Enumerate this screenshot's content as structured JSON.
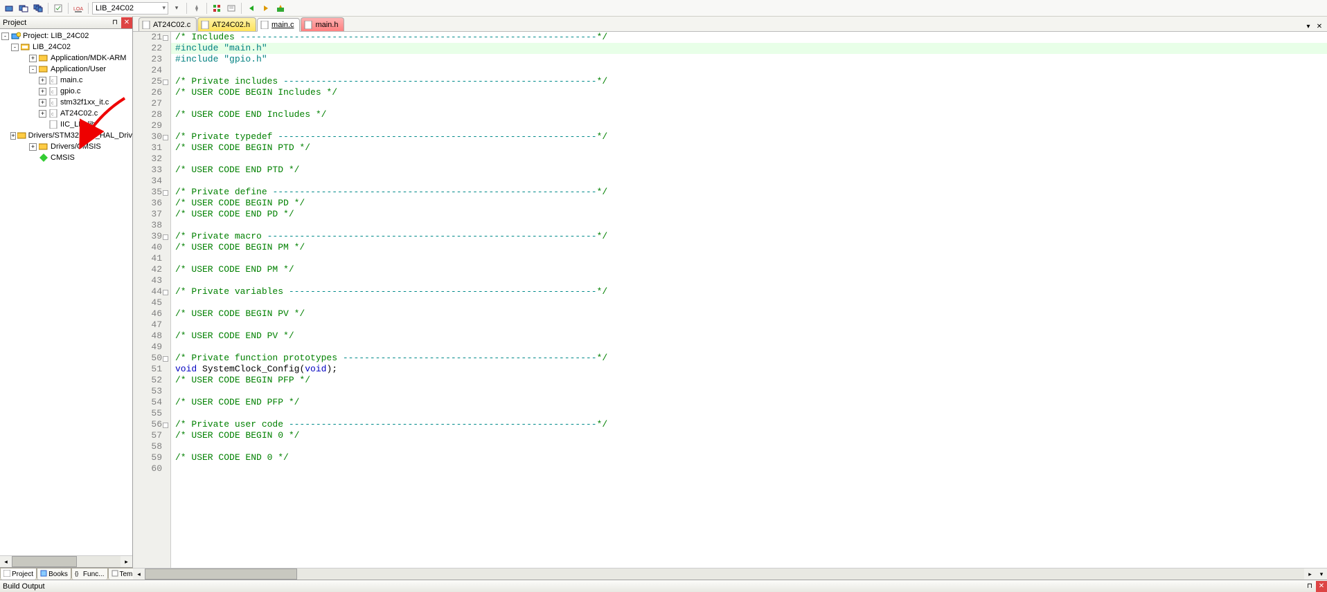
{
  "toolbar": {
    "target": "LIB_24C02"
  },
  "projectPanel": {
    "title": "Project",
    "root": "Project: LIB_24C02",
    "tree": {
      "rootGroup": "LIB_24C02",
      "nodes": [
        {
          "label": "Application/MDK-ARM",
          "icon": "folder",
          "indent": 3,
          "exp": "+"
        },
        {
          "label": "Application/User",
          "icon": "folder",
          "indent": 3,
          "exp": "-"
        },
        {
          "label": "main.c",
          "icon": "file-c",
          "indent": 4,
          "exp": "+"
        },
        {
          "label": "gpio.c",
          "icon": "file-c",
          "indent": 4,
          "exp": "+"
        },
        {
          "label": "stm32f1xx_it.c",
          "icon": "file-c",
          "indent": 4,
          "exp": "+"
        },
        {
          "label": "AT24C02.c",
          "icon": "file-c",
          "indent": 4,
          "exp": "+"
        },
        {
          "label": "IIC_LIB.lib",
          "icon": "file-lib",
          "indent": 4,
          "exp": ""
        },
        {
          "label": "Drivers/STM32F1xx_HAL_Driv",
          "icon": "folder",
          "indent": 3,
          "exp": "+"
        },
        {
          "label": "Drivers/CMSIS",
          "icon": "folder",
          "indent": 3,
          "exp": "+"
        },
        {
          "label": "CMSIS",
          "icon": "rte",
          "indent": 3,
          "exp": ""
        }
      ]
    },
    "bottomTabs": [
      "Project",
      "Books",
      "Func...",
      "Temp..."
    ]
  },
  "editor": {
    "tabs": [
      {
        "label": "AT24C02.c",
        "style": "normal"
      },
      {
        "label": "AT24C02.h",
        "style": "yellow"
      },
      {
        "label": "main.c",
        "style": "active underline"
      },
      {
        "label": "main.h",
        "style": "red"
      }
    ],
    "startLine": 21,
    "lines": [
      {
        "c": "cmt",
        "t": "/* Includes ------------------------------------------------------------------*/"
      },
      {
        "c": "pp",
        "t": "#include \"main.h\"",
        "hl": true
      },
      {
        "c": "pp",
        "t": "#include \"gpio.h\""
      },
      {
        "c": "",
        "t": ""
      },
      {
        "c": "cmt",
        "t": "/* Private includes ----------------------------------------------------------*/"
      },
      {
        "c": "cmt",
        "t": "/* USER CODE BEGIN Includes */"
      },
      {
        "c": "",
        "t": ""
      },
      {
        "c": "cmt",
        "t": "/* USER CODE END Includes */"
      },
      {
        "c": "",
        "t": ""
      },
      {
        "c": "cmt",
        "t": "/* Private typedef -----------------------------------------------------------*/"
      },
      {
        "c": "cmt",
        "t": "/* USER CODE BEGIN PTD */"
      },
      {
        "c": "",
        "t": ""
      },
      {
        "c": "cmt",
        "t": "/* USER CODE END PTD */"
      },
      {
        "c": "",
        "t": ""
      },
      {
        "c": "cmt",
        "t": "/* Private define ------------------------------------------------------------*/"
      },
      {
        "c": "cmt",
        "t": "/* USER CODE BEGIN PD */"
      },
      {
        "c": "cmt",
        "t": "/* USER CODE END PD */"
      },
      {
        "c": "",
        "t": ""
      },
      {
        "c": "cmt",
        "t": "/* Private macro -------------------------------------------------------------*/"
      },
      {
        "c": "cmt",
        "t": "/* USER CODE BEGIN PM */"
      },
      {
        "c": "",
        "t": ""
      },
      {
        "c": "cmt",
        "t": "/* USER CODE END PM */"
      },
      {
        "c": "",
        "t": ""
      },
      {
        "c": "cmt",
        "t": "/* Private variables ---------------------------------------------------------*/"
      },
      {
        "c": "",
        "t": ""
      },
      {
        "c": "cmt",
        "t": "/* USER CODE BEGIN PV */"
      },
      {
        "c": "",
        "t": ""
      },
      {
        "c": "cmt",
        "t": "/* USER CODE END PV */"
      },
      {
        "c": "",
        "t": ""
      },
      {
        "c": "cmt",
        "t": "/* Private function prototypes -----------------------------------------------*/"
      },
      {
        "c": "kw",
        "t": "void SystemClock_Config(void);"
      },
      {
        "c": "cmt",
        "t": "/* USER CODE BEGIN PFP */"
      },
      {
        "c": "",
        "t": ""
      },
      {
        "c": "cmt",
        "t": "/* USER CODE END PFP */"
      },
      {
        "c": "",
        "t": ""
      },
      {
        "c": "cmt",
        "t": "/* Private user code ---------------------------------------------------------*/"
      },
      {
        "c": "cmt",
        "t": "/* USER CODE BEGIN 0 */"
      },
      {
        "c": "",
        "t": ""
      },
      {
        "c": "cmt",
        "t": "/* USER CODE END 0 */"
      },
      {
        "c": "",
        "t": ""
      }
    ]
  },
  "buildOutput": {
    "title": "Build Output"
  }
}
